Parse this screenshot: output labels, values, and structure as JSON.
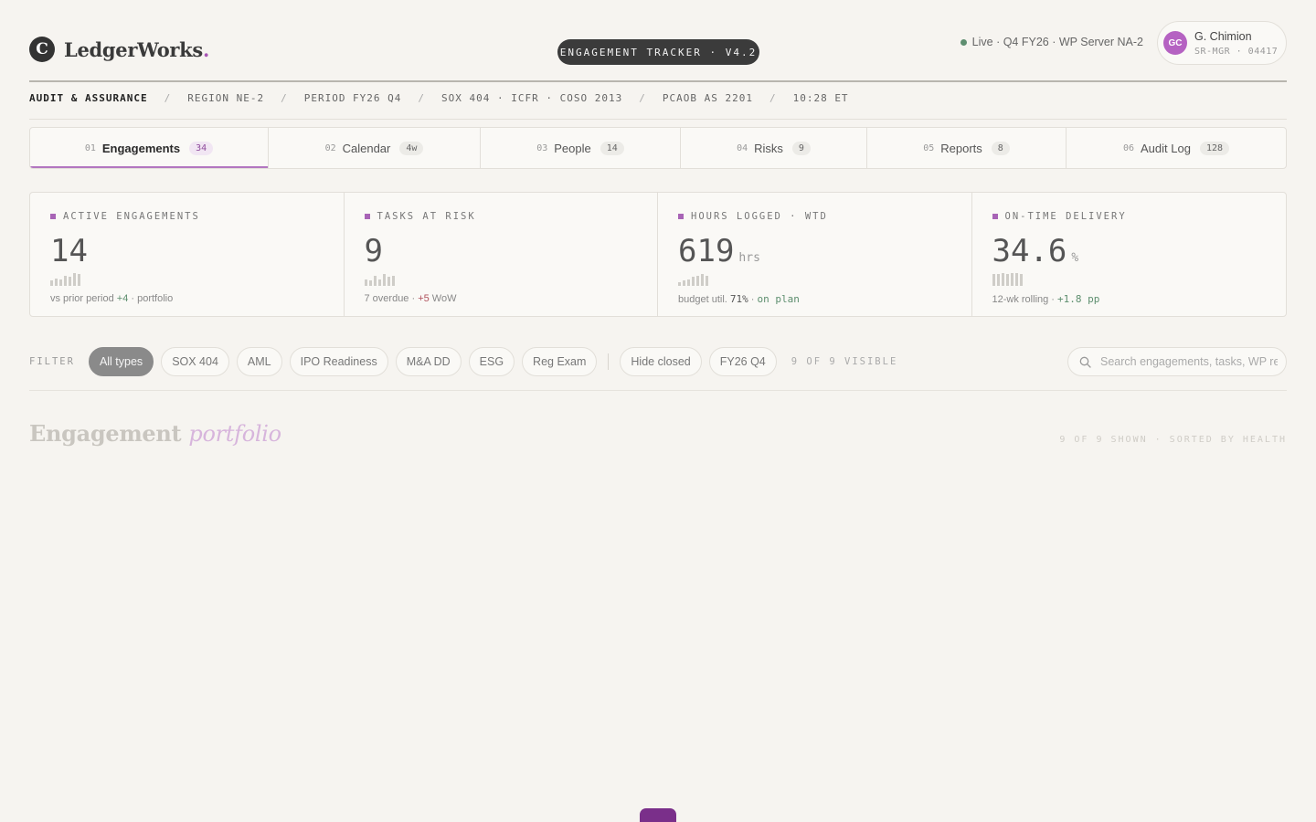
{
  "app": {
    "logo_letter": "C",
    "logo_name": "LedgerWorks",
    "logo_dot": ".",
    "tracker_label": "ENGAGEMENT TRACKER · V4.2",
    "status": "Live · Q4 FY26 · WP Server NA-2",
    "status_color": "#5e8e70",
    "accent_color": "#a864b6"
  },
  "user": {
    "initials": "GC",
    "name": "G. Chimion",
    "id": "SR-MGR · 04417"
  },
  "breadcrumb": [
    "AUDIT & ASSURANCE",
    "REGION NE-2",
    "PERIOD FY26 Q4",
    "SOX 404 · ICFR · COSO 2013",
    "PCAOB AS 2201",
    "10:28 ET"
  ],
  "breadcrumb_sep": "/",
  "tabs": [
    {
      "num": "01",
      "label": "Engagements",
      "badge": "34",
      "active": true
    },
    {
      "num": "02",
      "label": "Calendar",
      "badge": "4w",
      "active": false
    },
    {
      "num": "03",
      "label": "People",
      "badge": "14",
      "active": false
    },
    {
      "num": "04",
      "label": "Risks",
      "badge": "9",
      "active": false
    },
    {
      "num": "05",
      "label": "Reports",
      "badge": "8",
      "active": false
    },
    {
      "num": "06",
      "label": "Audit Log",
      "badge": "128",
      "active": false
    }
  ],
  "kpis": [
    {
      "label": "ACTIVE ENGAGEMENTS",
      "value": "14",
      "unit": "",
      "sub_a": "vs prior period ",
      "sub_b": "+4",
      "sub_c": " · portfolio",
      "spark": [
        0.4,
        0.6,
        0.5,
        0.8,
        0.7,
        1.0,
        0.9
      ]
    },
    {
      "label": "TASKS AT RISK",
      "value": "9",
      "unit": "",
      "sub_a": "7 overdue · ",
      "sub_b": "+5",
      "sub_c": " WoW",
      "spark": [
        0.5,
        0.4,
        0.8,
        0.5,
        0.9,
        0.7,
        0.8
      ]
    },
    {
      "label": "HOURS LOGGED · WTD",
      "value": "619",
      "unit": "hrs",
      "sub_a": "budget util. ",
      "sub_b": "71%",
      "sub_c": " · ",
      "sub_d": "on plan",
      "spark": [
        0.3,
        0.4,
        0.5,
        0.7,
        0.8,
        0.9,
        0.8
      ]
    },
    {
      "label": "ON-TIME DELIVERY",
      "value": "34.6",
      "unit": "%",
      "sub_a": "12-wk rolling · ",
      "sub_b": "+1.8 pp",
      "sub_c": "",
      "spark": [
        0.9,
        0.95,
        1.0,
        0.95,
        1.0,
        1.0,
        0.95
      ]
    }
  ],
  "filter": {
    "label": "FILTER",
    "chips": [
      "All types",
      "SOX 404",
      "AML",
      "IPO Readiness",
      "M&A DD",
      "ESG",
      "Reg Exam"
    ],
    "active_index": 0,
    "extra": [
      "Hide closed",
      "FY26 Q4"
    ],
    "visible": "9 OF 9 VISIBLE",
    "search_placeholder": "Search engagements, tasks, WP refs…"
  },
  "section": {
    "title_a": "Engagement",
    "title_b": "portfolio",
    "meta": "9 OF 9 SHOWN · SORTED BY HEALTH"
  }
}
